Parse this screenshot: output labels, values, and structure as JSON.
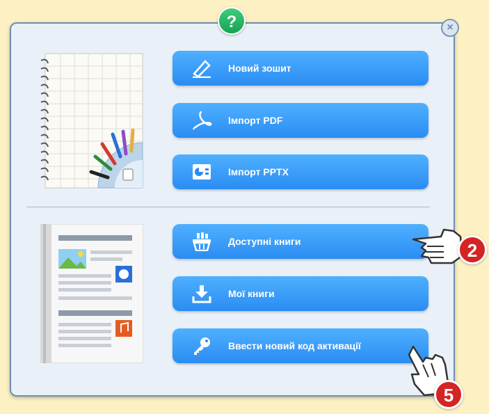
{
  "dialog": {
    "help_symbol": "?",
    "close_symbol": "×"
  },
  "buttons": [
    {
      "label": "Новий зошит",
      "icon": "pencil-icon"
    },
    {
      "label": "Імпорт PDF",
      "icon": "pdf-icon"
    },
    {
      "label": "Імпорт PPTX",
      "icon": "pptx-icon"
    },
    {
      "label": "Доступні книги",
      "icon": "basket-icon"
    },
    {
      "label": "Мої книги",
      "icon": "download-icon"
    },
    {
      "label": "Ввести новий код активації",
      "icon": "key-icon"
    }
  ],
  "callouts": {
    "first": "2",
    "second": "5"
  },
  "colors": {
    "background": "#fdf1c4",
    "button": "#2a8cf2",
    "badge": "#d42424",
    "help": "#17a354"
  }
}
